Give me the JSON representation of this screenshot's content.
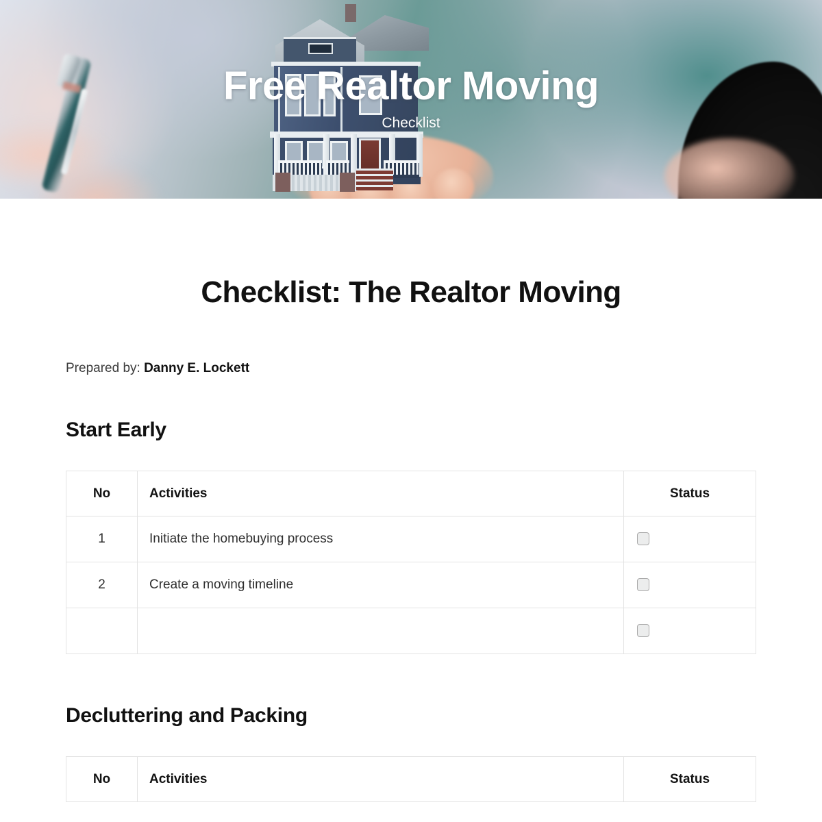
{
  "hero": {
    "title": "Free Realtor Moving",
    "subtitle": "Checklist",
    "image_alt": "realtor-house-in-hand-photo"
  },
  "document": {
    "title": "Checklist: The Realtor Moving",
    "prepared_by_label": "Prepared by:",
    "prepared_by_name": "Danny E. Lockett"
  },
  "columns": {
    "no": "No",
    "activities": "Activities",
    "status": "Status"
  },
  "sections": [
    {
      "heading": "Start Early",
      "rows": [
        {
          "no": "1",
          "activity": "Initiate the homebuying process",
          "checked": false
        },
        {
          "no": "2",
          "activity": "Create a moving timeline",
          "checked": false
        },
        {
          "no": "",
          "activity": "",
          "checked": false
        }
      ]
    },
    {
      "heading": "Decluttering and Packing",
      "rows": []
    }
  ],
  "colors": {
    "page_background": "#ffffff",
    "heading_text": "#111111",
    "body_text": "#2f2f2f",
    "table_border": "#e3e3e3",
    "checkbox_fill": "#eceded",
    "checkbox_border": "#a9a9a9",
    "hero_text": "#ffffff"
  }
}
